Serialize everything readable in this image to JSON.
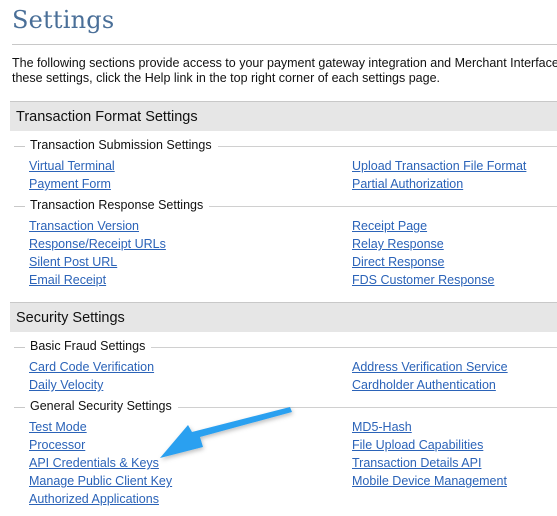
{
  "page": {
    "title": "Settings",
    "intro_line1": "The following sections provide access to your payment gateway integration and Merchant Interface set",
    "intro_line2": "these settings, click the Help link in the top right corner of each settings page."
  },
  "sections": [
    {
      "title": "Transaction Format Settings",
      "groups": [
        {
          "title": "Transaction Submission Settings",
          "left": [
            "Virtual Terminal",
            "Payment Form"
          ],
          "right": [
            "Upload Transaction File Format",
            "Partial Authorization"
          ]
        },
        {
          "title": "Transaction Response Settings",
          "left": [
            "Transaction Version",
            "Response/Receipt URLs",
            "Silent Post URL",
            "Email Receipt"
          ],
          "right": [
            "Receipt Page",
            "Relay Response",
            "Direct Response",
            "FDS Customer Response"
          ]
        }
      ]
    },
    {
      "title": "Security Settings",
      "groups": [
        {
          "title": "Basic Fraud Settings",
          "left": [
            "Card Code Verification",
            "Daily Velocity"
          ],
          "right": [
            "Address Verification Service",
            "Cardholder Authentication"
          ]
        },
        {
          "title": "General Security Settings",
          "left": [
            "Test Mode",
            "Processor",
            "API Credentials & Keys",
            "Manage Public Client Key",
            "Authorized Applications"
          ],
          "right": [
            "MD5-Hash",
            "File Upload Capabilities",
            "Transaction Details API",
            "Mobile Device Management"
          ]
        }
      ]
    }
  ],
  "annotation": {
    "icon": "arrow-annotation-icon",
    "color": "#2aa0f0",
    "points_to": "API Credentials & Keys"
  },
  "colors": {
    "title": "#4a6f98",
    "link": "#2b63b8",
    "section_bg": "#e6e6e6"
  }
}
